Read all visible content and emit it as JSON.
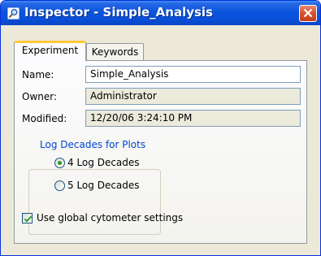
{
  "window": {
    "title": "Inspector - Simple_Analysis",
    "title_icon": "inspector-magnifier-icon",
    "close_icon": "close-icon"
  },
  "tabs": [
    {
      "label": "Experiment",
      "active": true
    },
    {
      "label": "Keywords",
      "active": false
    }
  ],
  "fields": {
    "name": {
      "label": "Name:",
      "value": "Simple_Analysis"
    },
    "owner": {
      "label": "Owner:",
      "value": "Administrator"
    },
    "modified": {
      "label": "Modified:",
      "value": "12/20/06 3:24:10 PM"
    }
  },
  "log_decades": {
    "legend": "Log Decades for Plots",
    "options": [
      {
        "label": "4 Log Decades",
        "selected": true
      },
      {
        "label": "5 Log Decades",
        "selected": false
      }
    ]
  },
  "global_settings": {
    "label": "Use global cytometer settings",
    "checked": true
  },
  "colors": {
    "titlebar": "#0a4fd8",
    "group_legend": "#0046d5",
    "radio_dot": "#21a121",
    "checkmark": "#21a121",
    "active_tab_highlight": "#ffc83c"
  }
}
